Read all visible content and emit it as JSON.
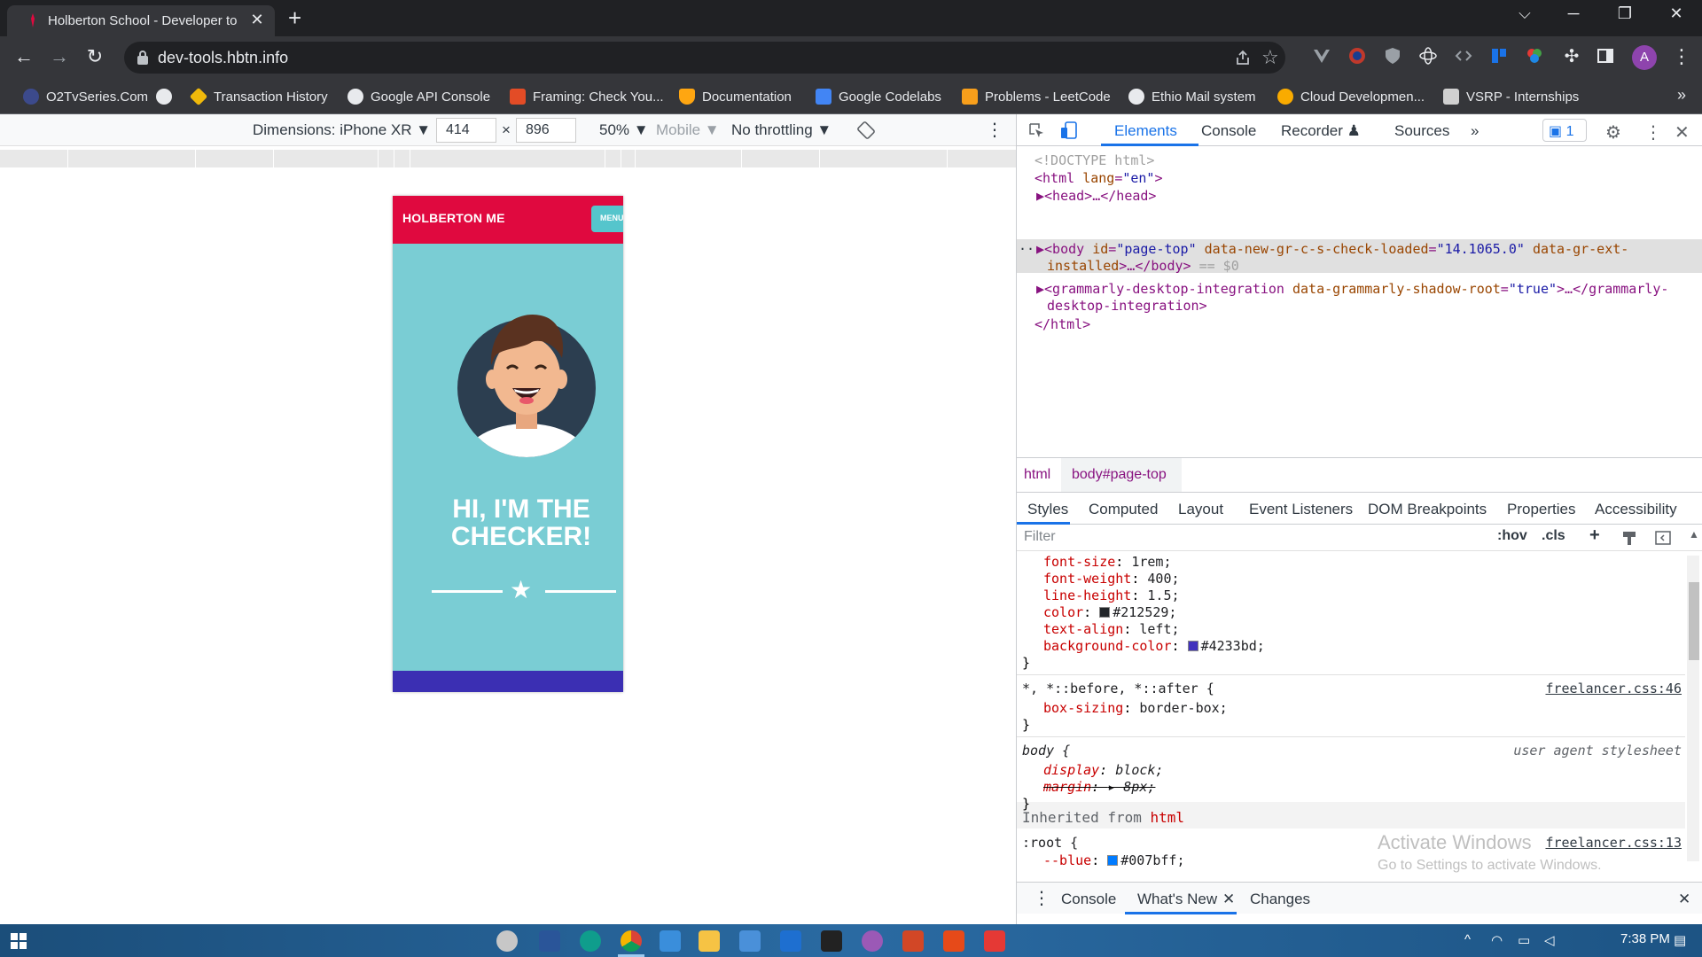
{
  "browser": {
    "tab_title": "Holberton School - Developer to",
    "tab_close": "✕",
    "new_tab": "+",
    "window": {
      "dropdown": "⌵",
      "minimize": "─",
      "restore": "❐",
      "close": "✕"
    },
    "url": "dev-tools.hbtn.info",
    "nav": {
      "back": "←",
      "forward": "→",
      "reload": "↻"
    }
  },
  "bookmarks": [
    {
      "label": "O2TvSeries.Com",
      "color": "#3c4a8c"
    },
    {
      "label": "",
      "color": "#e8eaed"
    },
    {
      "label": "Transaction History",
      "color": "#f0b90b"
    },
    {
      "label": "Google API Console",
      "color": "#e8eaed"
    },
    {
      "label": "Framing: Check You...",
      "color": "#e34c26"
    },
    {
      "label": "Documentation",
      "color": "#ffa611"
    },
    {
      "label": "Google Codelabs",
      "color": "#4285f4"
    },
    {
      "label": "Problems - LeetCode",
      "color": "#f89f1b"
    },
    {
      "label": "Ethio Mail system",
      "color": "#e8eaed"
    },
    {
      "label": "Cloud Developmen...",
      "color": "#f9ab00"
    },
    {
      "label": "VSRP - Internships",
      "color": "#d0d0d0"
    }
  ],
  "bookmarks_more": "»",
  "device_toolbar": {
    "dimensions": "Dimensions: iPhone XR ▼",
    "width": "414",
    "times": "×",
    "height": "896",
    "zoom": "50% ▼",
    "mode": "Mobile ▼",
    "throttling": "No throttling ▼",
    "more": "⋮"
  },
  "phone": {
    "brand": "HOLBERTON ME",
    "menu": "MENU",
    "headline": "HI, I'M THE CHECKER!",
    "star": "★"
  },
  "devtools": {
    "tabs": [
      "Elements",
      "Console",
      "Recorder ♟",
      "Sources",
      "»"
    ],
    "issues": "1",
    "close": "✕",
    "more": "⋮",
    "dom": {
      "doctype": "<!DOCTYPE html>",
      "html_open_tag": "<html ",
      "html_attr": "lang",
      "html_val": "\"en\"",
      "html_open_end": ">",
      "head": "▶<head>…</head>",
      "body_ellipsis": "···",
      "body_tag": "▶<body ",
      "body_id_attr": "id",
      "body_id_val": "\"page-top\"",
      "body_attr2": "data-new-gr-c-s-check-loaded",
      "body_val2": "\"14.1065.0\"",
      "body_attr3": "data-gr-ext-",
      "body_line2_attr": "installed",
      "body_line2_rest": ">…</body>",
      "body_eq": " == $0",
      "gram_tag": "▶<grammarly-desktop-integration ",
      "gram_attr": "data-grammarly-shadow-root",
      "gram_val": "\"true\"",
      "gram_rest": ">…</grammarly-",
      "gram_line2": "desktop-integration>",
      "html_close": "</html>"
    },
    "breadcrumbs": [
      "html",
      "body#page-top"
    ],
    "subtabs": [
      "Styles",
      "Computed",
      "Layout",
      "Event Listeners",
      "DOM Breakpoints",
      "Properties",
      "Accessibility"
    ],
    "filter_placeholder": "Filter",
    "filter_hov": ":hov",
    "filter_cls": ".cls",
    "filter_add": "+",
    "styles": {
      "body_props": [
        {
          "name": "font-size",
          "value": "1rem;"
        },
        {
          "name": "font-weight",
          "value": "400;"
        },
        {
          "name": "line-height",
          "value": "1.5;"
        },
        {
          "name": "color",
          "value": "#212529;",
          "swatch": "#212529"
        },
        {
          "name": "text-align",
          "value": "left;"
        },
        {
          "name": "background-color",
          "value": "#4233bd;",
          "swatch": "#4233bd"
        }
      ],
      "brace_close": "}",
      "universal_selector": "*, *::before, *::after {",
      "universal_src": "freelancer.css:46",
      "universal_prop": "box-sizing",
      "universal_val": "border-box;",
      "ua_selector": "body {",
      "ua_src": "user agent stylesheet",
      "ua_prop1": "display",
      "ua_val1": "block;",
      "ua_prop2": "margin",
      "ua_val2": "▸ 8px;",
      "inherited_label": "Inherited from",
      "inherited_tag": "html",
      "root_selector": ":root {",
      "root_src": "freelancer.css:13",
      "root_prop": "--blue",
      "root_val": "#007bff;",
      "root_swatch": "#007bff"
    },
    "drawer_tabs": [
      "Console",
      "What's New",
      "Changes"
    ],
    "drawer_close": "✕"
  },
  "watermark": {
    "line1": "Activate Windows",
    "line2": "Go to Settings to activate Windows."
  },
  "taskbar": {
    "time": "7:38 PM",
    "chevron": "^"
  }
}
